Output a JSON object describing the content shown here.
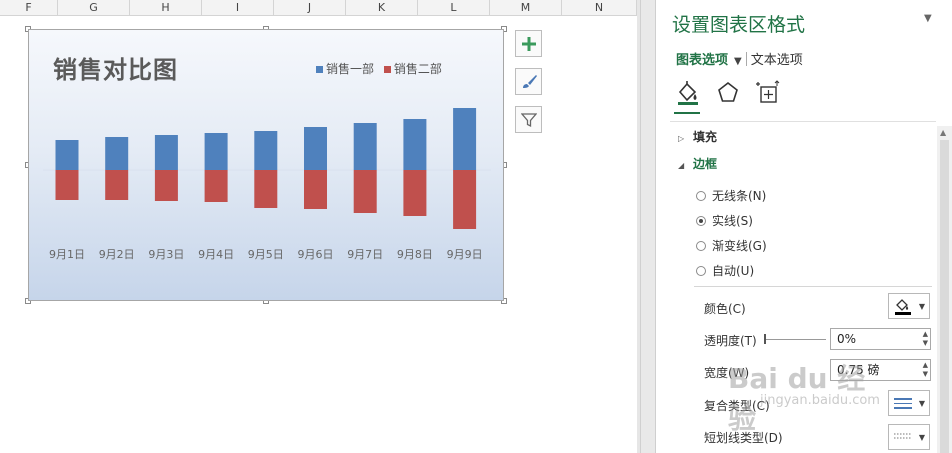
{
  "sheet": {
    "column_headers": [
      "F",
      "G",
      "H",
      "I",
      "J",
      "K",
      "L",
      "M",
      "N"
    ]
  },
  "chart_data": {
    "type": "bar",
    "title": "销售对比图",
    "categories": [
      "9月1日",
      "9月2日",
      "9月3日",
      "9月4日",
      "9月5日",
      "9月6日",
      "9月7日",
      "9月8日",
      "9月9日"
    ],
    "series": [
      {
        "name": "销售一部",
        "color": "#4f81bd",
        "values": [
          30,
          33,
          35,
          37,
          39,
          43,
          47,
          51,
          62
        ]
      },
      {
        "name": "销售二部",
        "color": "#c0504d",
        "values": [
          -30,
          -30,
          -31,
          -32,
          -38,
          -39,
          -43,
          -46,
          -59
        ]
      }
    ],
    "legend_position": "top-right",
    "gridlines": false,
    "ylim": [
      -60,
      65
    ]
  },
  "chart_tools": {
    "add_icon": "plus-icon",
    "style_icon": "brush-icon",
    "filter_icon": "funnel-icon"
  },
  "panel": {
    "title": "设置图表区格式",
    "tab_chart_options": "图表选项",
    "tab_text_options": "文本选项",
    "icon_tabs": [
      "fill-line-icon",
      "effects-icon",
      "size-properties-icon"
    ],
    "section_fill": "填充",
    "section_border": "边框",
    "border_options": [
      {
        "label": "无线条(N)",
        "checked": false
      },
      {
        "label": "实线(S)",
        "checked": true
      },
      {
        "label": "渐变线(G)",
        "checked": false
      },
      {
        "label": "自动(U)",
        "checked": false
      }
    ],
    "color_label": "颜色(C)",
    "transparency_label": "透明度(T)",
    "transparency_value": "0%",
    "width_label": "宽度(W)",
    "width_value": "0.75 磅",
    "compound_type_label": "复合类型(C)",
    "dash_type_label": "短划线类型(D)",
    "accent_color": "#217346"
  },
  "watermark": {
    "main": "Bai du 经验",
    "sub": "jingyan.baidu.com"
  }
}
